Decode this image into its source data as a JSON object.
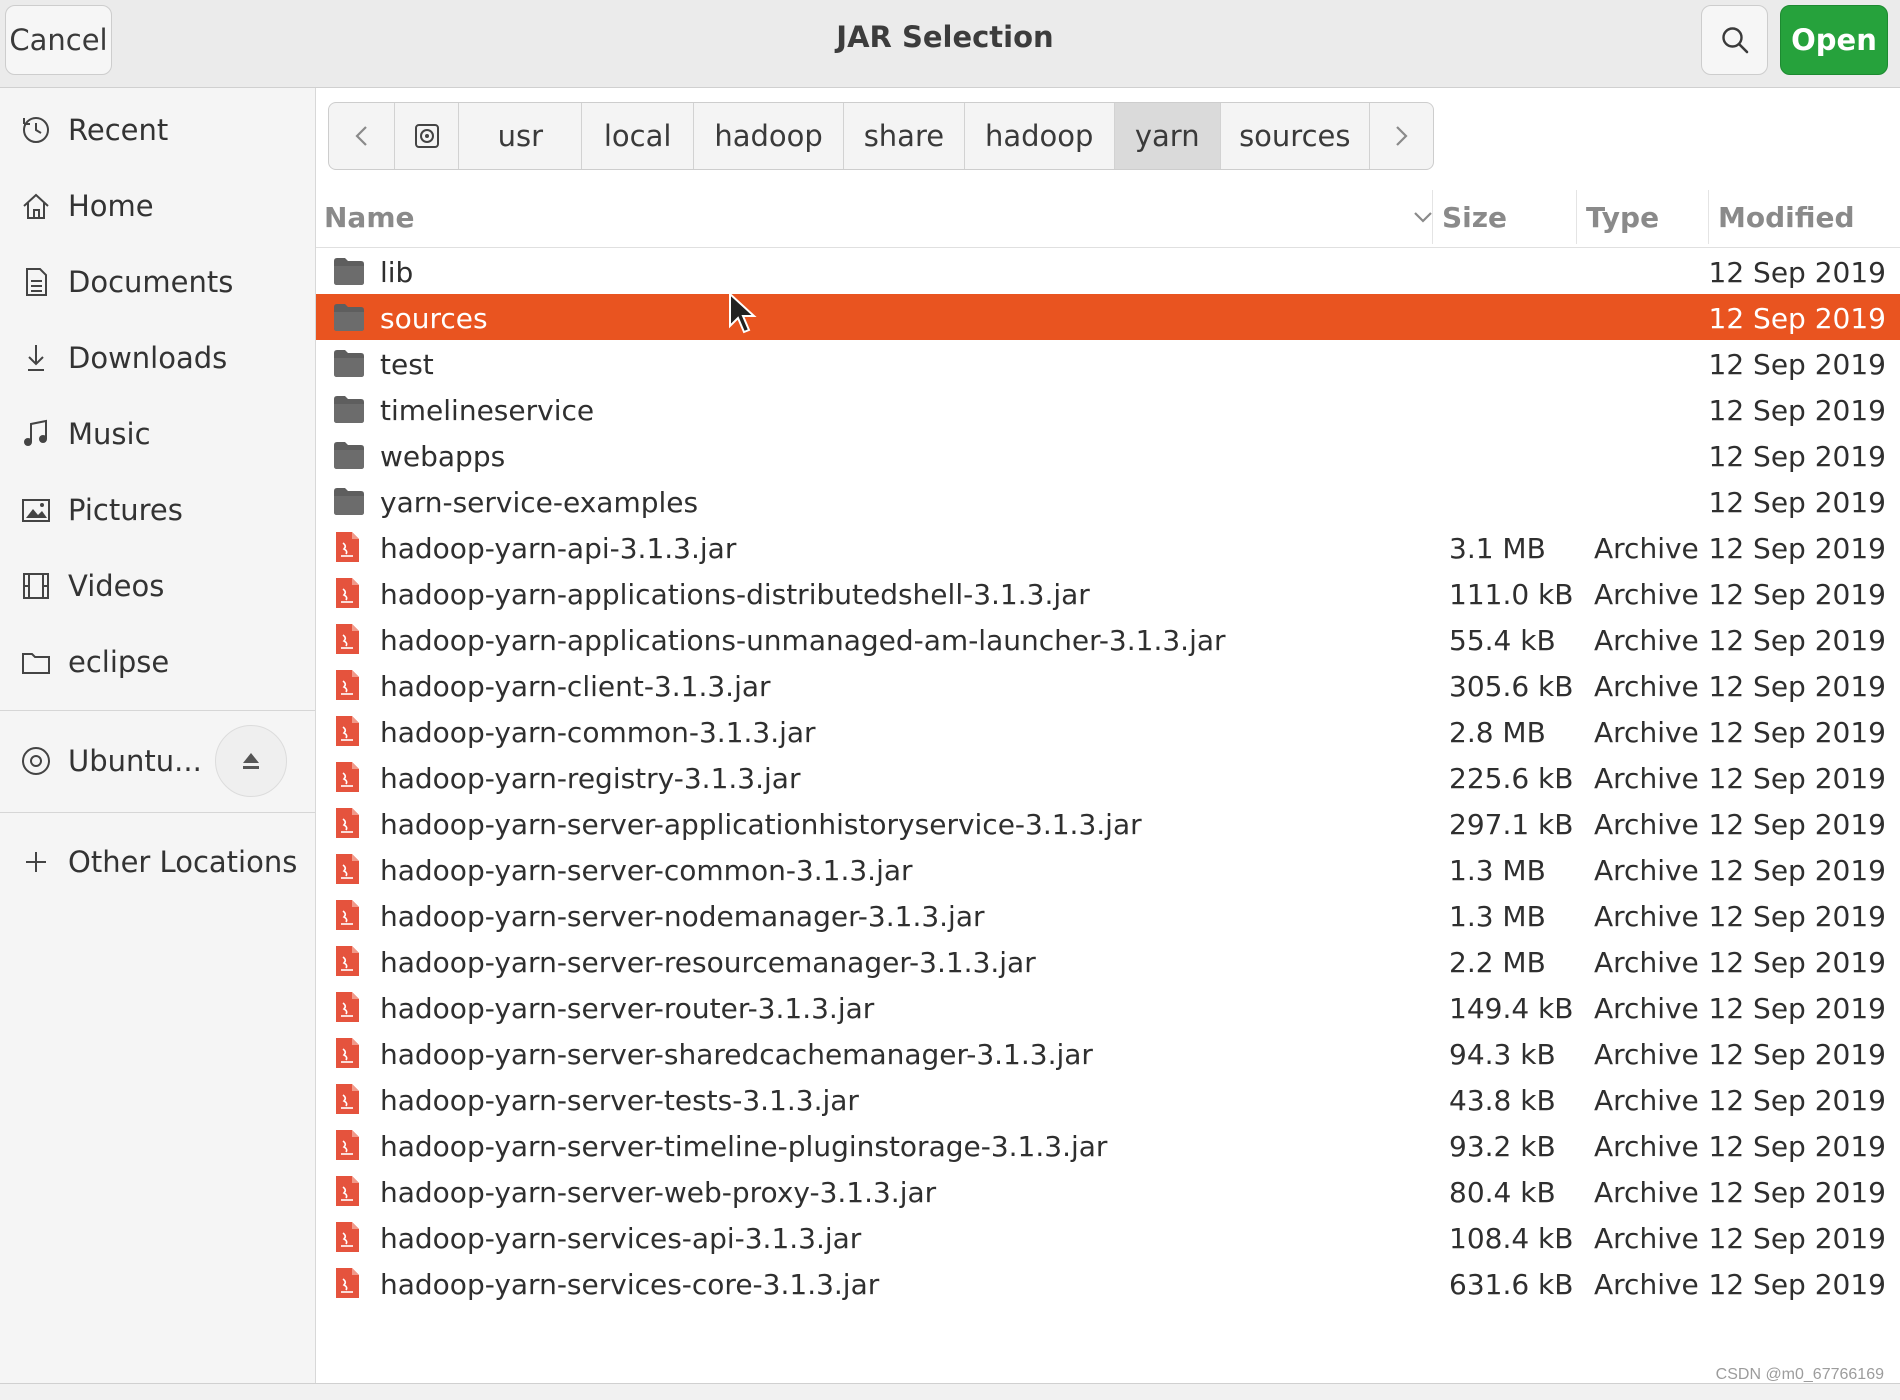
{
  "header": {
    "cancel_label": "Cancel",
    "title": "JAR Selection",
    "open_label": "Open",
    "accent_color": "#26a23c"
  },
  "sidebar": {
    "items": [
      {
        "label": "Recent",
        "icon": "clock-icon"
      },
      {
        "label": "Home",
        "icon": "home-icon"
      },
      {
        "label": "Documents",
        "icon": "document-icon"
      },
      {
        "label": "Downloads",
        "icon": "download-icon"
      },
      {
        "label": "Music",
        "icon": "music-icon"
      },
      {
        "label": "Pictures",
        "icon": "picture-icon"
      },
      {
        "label": "Videos",
        "icon": "film-icon"
      },
      {
        "label": "eclipse",
        "icon": "folder-icon"
      }
    ],
    "device": {
      "label": "Ubuntu...",
      "icon": "disc-icon"
    },
    "other_locations": "Other Locations"
  },
  "pathbar": {
    "segments": [
      "usr",
      "local",
      "hadoop",
      "share",
      "hadoop",
      "yarn",
      "sources"
    ],
    "active_segment": "yarn"
  },
  "columns": {
    "name": "Name",
    "size": "Size",
    "type": "Type",
    "modified": "Modified"
  },
  "selection_color": "#e95420",
  "files": [
    {
      "name": "lib",
      "size": "",
      "type": "",
      "modified": "12 Sep 2019",
      "kind": "folder"
    },
    {
      "name": "sources",
      "size": "",
      "type": "",
      "modified": "12 Sep 2019",
      "kind": "folder",
      "selected": true
    },
    {
      "name": "test",
      "size": "",
      "type": "",
      "modified": "12 Sep 2019",
      "kind": "folder"
    },
    {
      "name": "timelineservice",
      "size": "",
      "type": "",
      "modified": "12 Sep 2019",
      "kind": "folder"
    },
    {
      "name": "webapps",
      "size": "",
      "type": "",
      "modified": "12 Sep 2019",
      "kind": "folder"
    },
    {
      "name": "yarn-service-examples",
      "size": "",
      "type": "",
      "modified": "12 Sep 2019",
      "kind": "folder"
    },
    {
      "name": "hadoop-yarn-api-3.1.3.jar",
      "size": "3.1 MB",
      "type": "Archive",
      "modified": "12 Sep 2019",
      "kind": "jar"
    },
    {
      "name": "hadoop-yarn-applications-distributedshell-3.1.3.jar",
      "size": "111.0 kB",
      "type": "Archive",
      "modified": "12 Sep 2019",
      "kind": "jar"
    },
    {
      "name": "hadoop-yarn-applications-unmanaged-am-launcher-3.1.3.jar",
      "size": "55.4 kB",
      "type": "Archive",
      "modified": "12 Sep 2019",
      "kind": "jar"
    },
    {
      "name": "hadoop-yarn-client-3.1.3.jar",
      "size": "305.6 kB",
      "type": "Archive",
      "modified": "12 Sep 2019",
      "kind": "jar"
    },
    {
      "name": "hadoop-yarn-common-3.1.3.jar",
      "size": "2.8 MB",
      "type": "Archive",
      "modified": "12 Sep 2019",
      "kind": "jar"
    },
    {
      "name": "hadoop-yarn-registry-3.1.3.jar",
      "size": "225.6 kB",
      "type": "Archive",
      "modified": "12 Sep 2019",
      "kind": "jar"
    },
    {
      "name": "hadoop-yarn-server-applicationhistoryservice-3.1.3.jar",
      "size": "297.1 kB",
      "type": "Archive",
      "modified": "12 Sep 2019",
      "kind": "jar"
    },
    {
      "name": "hadoop-yarn-server-common-3.1.3.jar",
      "size": "1.3 MB",
      "type": "Archive",
      "modified": "12 Sep 2019",
      "kind": "jar"
    },
    {
      "name": "hadoop-yarn-server-nodemanager-3.1.3.jar",
      "size": "1.3 MB",
      "type": "Archive",
      "modified": "12 Sep 2019",
      "kind": "jar"
    },
    {
      "name": "hadoop-yarn-server-resourcemanager-3.1.3.jar",
      "size": "2.2 MB",
      "type": "Archive",
      "modified": "12 Sep 2019",
      "kind": "jar"
    },
    {
      "name": "hadoop-yarn-server-router-3.1.3.jar",
      "size": "149.4 kB",
      "type": "Archive",
      "modified": "12 Sep 2019",
      "kind": "jar"
    },
    {
      "name": "hadoop-yarn-server-sharedcachemanager-3.1.3.jar",
      "size": "94.3 kB",
      "type": "Archive",
      "modified": "12 Sep 2019",
      "kind": "jar"
    },
    {
      "name": "hadoop-yarn-server-tests-3.1.3.jar",
      "size": "43.8 kB",
      "type": "Archive",
      "modified": "12 Sep 2019",
      "kind": "jar"
    },
    {
      "name": "hadoop-yarn-server-timeline-pluginstorage-3.1.3.jar",
      "size": "93.2 kB",
      "type": "Archive",
      "modified": "12 Sep 2019",
      "kind": "jar"
    },
    {
      "name": "hadoop-yarn-server-web-proxy-3.1.3.jar",
      "size": "80.4 kB",
      "type": "Archive",
      "modified": "12 Sep 2019",
      "kind": "jar"
    },
    {
      "name": "hadoop-yarn-services-api-3.1.3.jar",
      "size": "108.4 kB",
      "type": "Archive",
      "modified": "12 Sep 2019",
      "kind": "jar"
    },
    {
      "name": "hadoop-yarn-services-core-3.1.3.jar",
      "size": "631.6 kB",
      "type": "Archive",
      "modified": "12 Sep 2019",
      "kind": "jar"
    }
  ],
  "watermark": "CSDN @m0_67766169"
}
